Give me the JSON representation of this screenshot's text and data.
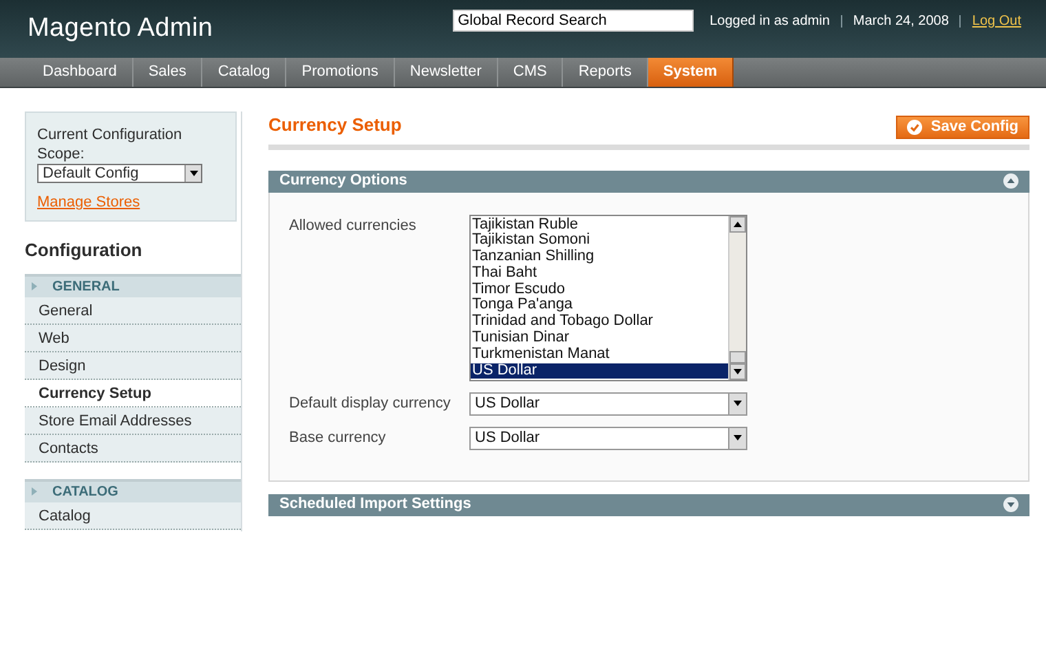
{
  "header": {
    "logo": "Magento Admin",
    "search": {
      "value": "Global Record Search"
    },
    "user": "Logged in as admin",
    "date": "March 24, 2008",
    "logout": "Log Out"
  },
  "nav": [
    {
      "label": "Dashboard",
      "selected": false
    },
    {
      "label": "Sales",
      "selected": false
    },
    {
      "label": "Catalog",
      "selected": false
    },
    {
      "label": "Promotions",
      "selected": false
    },
    {
      "label": "Newsletter",
      "selected": false
    },
    {
      "label": "CMS",
      "selected": false
    },
    {
      "label": "Reports",
      "selected": false
    },
    {
      "label": "System",
      "selected": true
    }
  ],
  "sidebar": {
    "scope_label": "Current Configuration Scope:",
    "scope": "Default Config",
    "manage_stores": "Manage Stores",
    "title": "Configuration",
    "groups": [
      {
        "label": "GENERAL",
        "items": [
          {
            "label": "General",
            "selected": false
          },
          {
            "label": "Web",
            "selected": false
          },
          {
            "label": "Design",
            "selected": false
          },
          {
            "label": "Currency Setup",
            "selected": true
          },
          {
            "label": "Store Email Addresses",
            "selected": false
          },
          {
            "label": "Contacts",
            "selected": false
          }
        ]
      },
      {
        "label": "CATALOG",
        "items": [
          {
            "label": "Catalog",
            "selected": false
          }
        ]
      }
    ]
  },
  "page": {
    "title": "Currency Setup",
    "save": "Save Config",
    "sections": [
      {
        "title": "Currency Options",
        "expanded": true,
        "fields": [
          {
            "kind": "multiselect",
            "label": "Allowed currencies",
            "options": [
              {
                "label": "Tajikistan Ruble",
                "selected": false
              },
              {
                "label": "Tajikistan Somoni",
                "selected": false
              },
              {
                "label": "Tanzanian Shilling",
                "selected": false
              },
              {
                "label": "Thai Baht",
                "selected": false
              },
              {
                "label": "Timor Escudo",
                "selected": false
              },
              {
                "label": "Tonga Pa'anga",
                "selected": false
              },
              {
                "label": "Trinidad and Tobago Dollar",
                "selected": false
              },
              {
                "label": "Tunisian Dinar",
                "selected": false
              },
              {
                "label": "Turkmenistan Manat",
                "selected": false
              },
              {
                "label": "US Dollar",
                "selected": true
              }
            ]
          },
          {
            "kind": "select",
            "label": "Default display currency",
            "value": "US Dollar"
          },
          {
            "kind": "select",
            "label": "Base currency",
            "value": "US Dollar"
          }
        ]
      },
      {
        "title": "Scheduled Import Settings",
        "expanded": false
      }
    ]
  }
}
